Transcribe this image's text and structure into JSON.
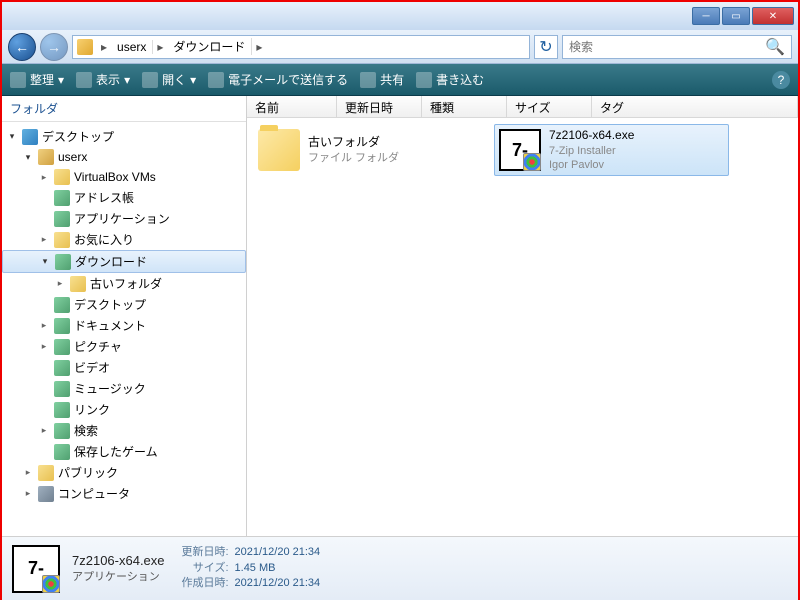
{
  "breadcrumb": {
    "seg1": "userx",
    "seg2": "ダウンロード"
  },
  "search": {
    "placeholder": "検索"
  },
  "toolbar": {
    "organize": "整理",
    "view": "表示",
    "open": "開く",
    "email": "電子メールで送信する",
    "share": "共有",
    "burn": "書き込む"
  },
  "sidebar": {
    "header": "フォルダ",
    "tree": [
      {
        "label": "デスクトップ",
        "depth": 0,
        "arrow": "▾",
        "icon": "icon-desktop"
      },
      {
        "label": "userx",
        "depth": 1,
        "arrow": "▾",
        "icon": "icon-user"
      },
      {
        "label": "VirtualBox VMs",
        "depth": 2,
        "arrow": "▸",
        "icon": "icon-folder"
      },
      {
        "label": "アドレス帳",
        "depth": 2,
        "arrow": "",
        "icon": "icon-special"
      },
      {
        "label": "アプリケーション",
        "depth": 2,
        "arrow": "",
        "icon": "icon-special"
      },
      {
        "label": "お気に入り",
        "depth": 2,
        "arrow": "▸",
        "icon": "icon-folder"
      },
      {
        "label": "ダウンロード",
        "depth": 2,
        "arrow": "▾",
        "icon": "icon-special",
        "selected": true
      },
      {
        "label": "古いフォルダ",
        "depth": 3,
        "arrow": "▸",
        "icon": "icon-folder"
      },
      {
        "label": "デスクトップ",
        "depth": 2,
        "arrow": "",
        "icon": "icon-special"
      },
      {
        "label": "ドキュメント",
        "depth": 2,
        "arrow": "▸",
        "icon": "icon-special"
      },
      {
        "label": "ピクチャ",
        "depth": 2,
        "arrow": "▸",
        "icon": "icon-special"
      },
      {
        "label": "ビデオ",
        "depth": 2,
        "arrow": "",
        "icon": "icon-special"
      },
      {
        "label": "ミュージック",
        "depth": 2,
        "arrow": "",
        "icon": "icon-special"
      },
      {
        "label": "リンク",
        "depth": 2,
        "arrow": "",
        "icon": "icon-special"
      },
      {
        "label": "検索",
        "depth": 2,
        "arrow": "▸",
        "icon": "icon-special"
      },
      {
        "label": "保存したゲーム",
        "depth": 2,
        "arrow": "",
        "icon": "icon-special"
      },
      {
        "label": "パブリック",
        "depth": 1,
        "arrow": "▸",
        "icon": "icon-folder"
      },
      {
        "label": "コンピュータ",
        "depth": 1,
        "arrow": "▸",
        "icon": "icon-computer"
      }
    ]
  },
  "columns": {
    "name": "名前",
    "date": "更新日時",
    "type": "種類",
    "size": "サイズ",
    "tag": "タグ"
  },
  "files": [
    {
      "name": "古いフォルダ",
      "sub1": "ファイル フォルダ",
      "sub2": "",
      "kind": "folder",
      "selected": false
    },
    {
      "name": "7z2106-x64.exe",
      "sub1": "7-Zip Installer",
      "sub2": "Igor Pavlov",
      "kind": "exe",
      "selected": true
    }
  ],
  "details": {
    "name": "7z2106-x64.exe",
    "type": "アプリケーション",
    "mod_label": "更新日時:",
    "mod": "2021/12/20 21:34",
    "size_label": "サイズ:",
    "size": "1.45 MB",
    "created_label": "作成日時:",
    "created": "2021/12/20 21:34"
  }
}
